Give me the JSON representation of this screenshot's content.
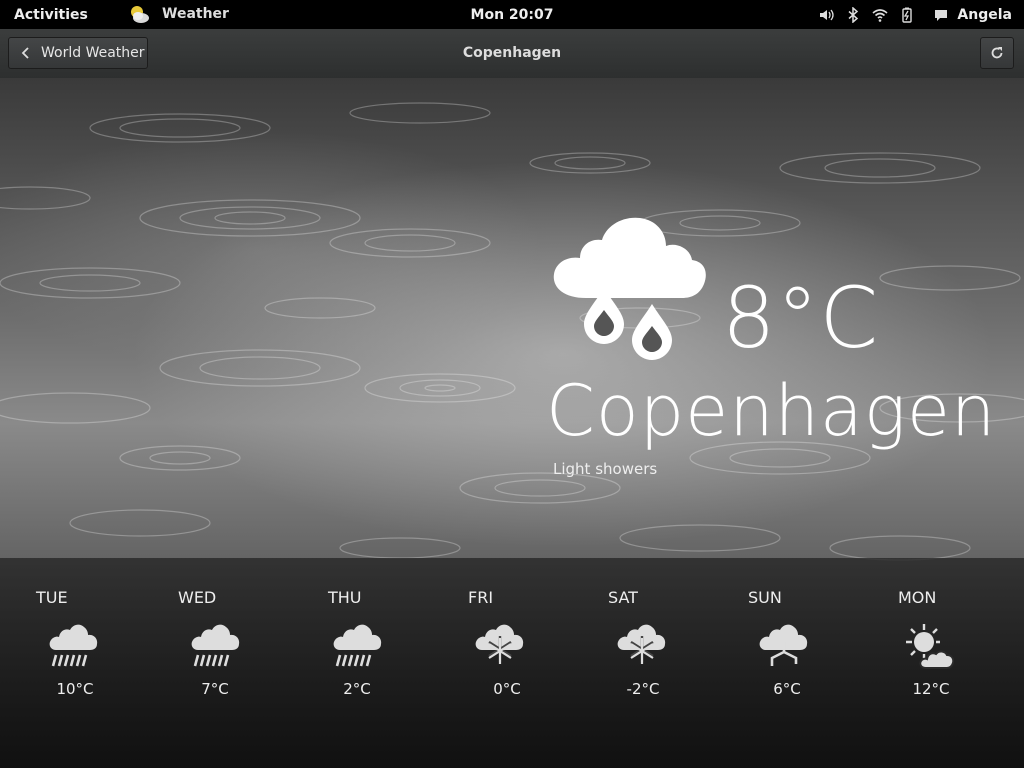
{
  "topbar": {
    "activities": "Activities",
    "app_name": "Weather",
    "clock": "Mon 20:07",
    "user": "Angela"
  },
  "header": {
    "back_label": "World Weather",
    "title": "Copenhagen"
  },
  "current": {
    "temperature": "8°C",
    "city": "Copenhagen",
    "condition": "Light showers",
    "icon": "cloud-rain-drops-icon"
  },
  "forecast": [
    {
      "day": "TUE",
      "temp": "10°C",
      "icon": "cloud-rain-icon"
    },
    {
      "day": "WED",
      "temp": "7°C",
      "icon": "cloud-rain-icon"
    },
    {
      "day": "THU",
      "temp": "2°C",
      "icon": "cloud-rain-icon"
    },
    {
      "day": "FRI",
      "temp": "0°C",
      "icon": "cloud-snow-icon"
    },
    {
      "day": "SAT",
      "temp": "-2°C",
      "icon": "cloud-snow-icon"
    },
    {
      "day": "SUN",
      "temp": "6°C",
      "icon": "cloud-storm-icon"
    },
    {
      "day": "MON",
      "temp": "12°C",
      "icon": "sun-cloud-icon"
    }
  ]
}
